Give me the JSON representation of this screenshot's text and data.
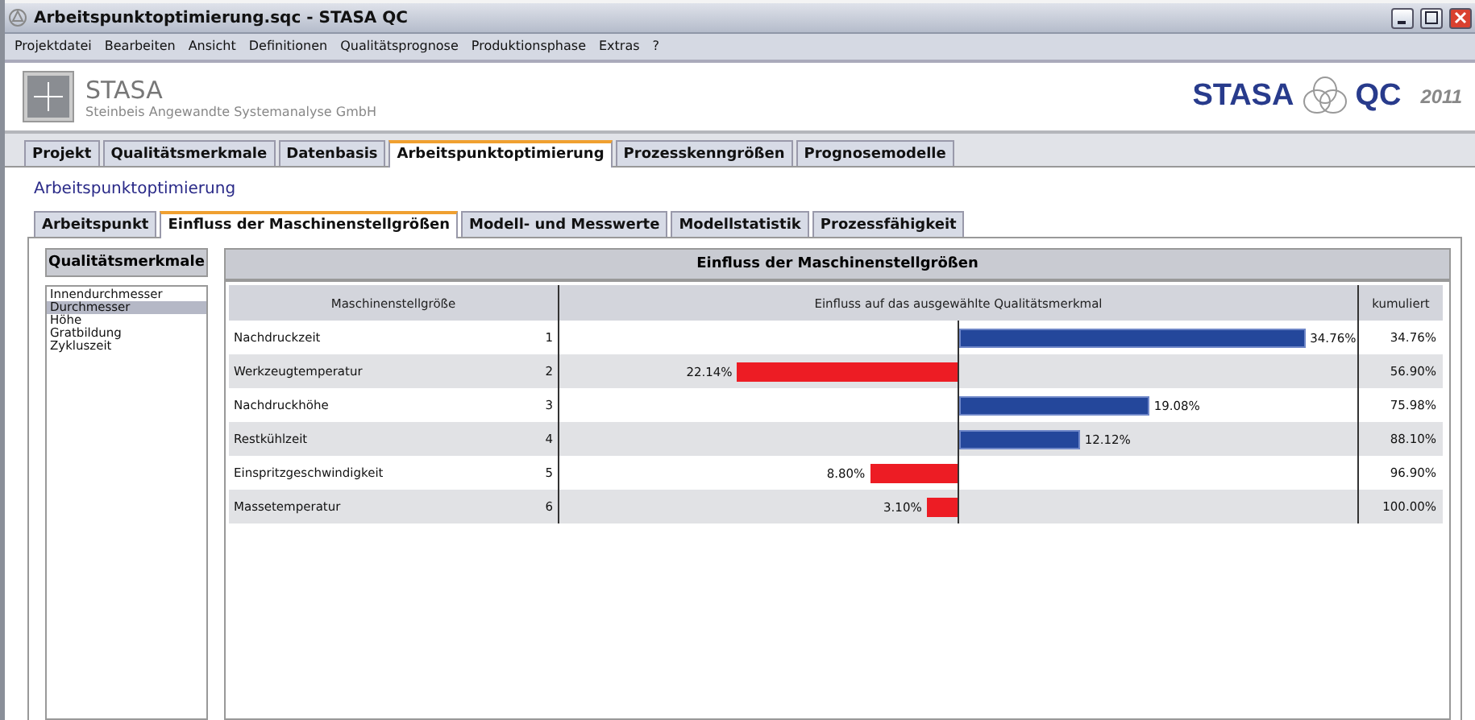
{
  "window": {
    "title": "Arbeitspunktoptimierung.sqc - STASA QC"
  },
  "menu": [
    "Projektdatei",
    "Bearbeiten",
    "Ansicht",
    "Definitionen",
    "Qualitätsprognose",
    "Produktionsphase",
    "Extras",
    "?"
  ],
  "header": {
    "logo_text": "STASA",
    "company": "Steinbeis Angewandte Systemanalyse GmbH",
    "product_left": "STASA",
    "product_right": "QC",
    "year": "2011"
  },
  "tabs": [
    {
      "label": "Projekt",
      "selected": false
    },
    {
      "label": "Qualitätsmerkmale",
      "selected": false
    },
    {
      "label": "Datenbasis",
      "selected": false
    },
    {
      "label": "Arbeitspunktoptimierung",
      "selected": true
    },
    {
      "label": "Prozesskenngrößen",
      "selected": false
    },
    {
      "label": "Prognosemodelle",
      "selected": false
    }
  ],
  "page_title": "Arbeitspunktoptimierung",
  "subtabs": [
    {
      "label": "Arbeitspunkt",
      "selected": false
    },
    {
      "label": "Einfluss der Maschinenstellgrößen",
      "selected": true
    },
    {
      "label": "Modell- und Messwerte",
      "selected": false
    },
    {
      "label": "Modellstatistik",
      "selected": false
    },
    {
      "label": "Prozessfähigkeit",
      "selected": false
    }
  ],
  "features": {
    "title": "Qualitätsmerkmale",
    "items": [
      {
        "label": "Innendurchmesser",
        "selected": false
      },
      {
        "label": "Durchmesser",
        "selected": true
      },
      {
        "label": "Höhe",
        "selected": false
      },
      {
        "label": "Gratbildung",
        "selected": false
      },
      {
        "label": "Zykluszeit",
        "selected": false
      }
    ]
  },
  "influence": {
    "title": "Einfluss der Maschinenstellgrößen",
    "columns": [
      "Maschinenstellgröße",
      "Einfluss auf das ausgewählte Qualitätsmerkmal",
      "kumuliert"
    ],
    "rows": [
      {
        "name": "Nachdruckzeit",
        "rank": "1",
        "kind": "positive",
        "value": "34.76%",
        "cumulative": "34.76%"
      },
      {
        "name": "Werkzeugtemperatur",
        "rank": "2",
        "kind": "negative",
        "value": "22.14%",
        "cumulative": "56.90%"
      },
      {
        "name": "Nachdruckhöhe",
        "rank": "3",
        "kind": "positive",
        "value": "19.08%",
        "cumulative": "75.98%"
      },
      {
        "name": "Restkühlzeit",
        "rank": "4",
        "kind": "positive",
        "value": "12.12%",
        "cumulative": "88.10%"
      },
      {
        "name": "Einspritzgeschwindigkeit",
        "rank": "5",
        "kind": "negative",
        "value": "8.80%",
        "cumulative": "96.90%"
      },
      {
        "name": "Massetemperatur",
        "rank": "6",
        "kind": "negative",
        "value": "3.10%",
        "cumulative": "100.00%"
      }
    ]
  }
}
